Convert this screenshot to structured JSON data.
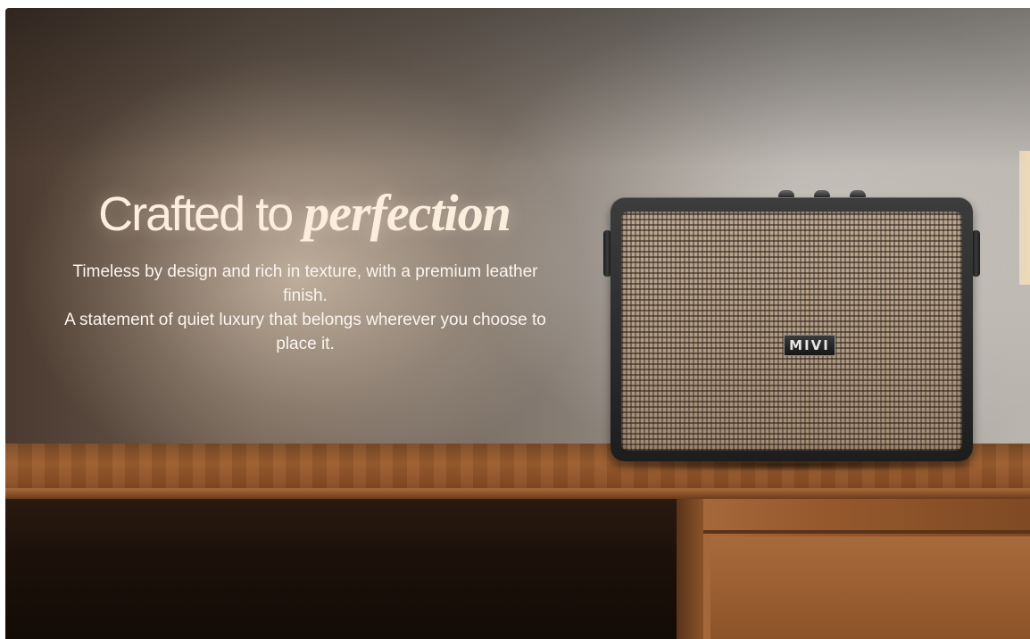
{
  "hero": {
    "headline_plain": "Crafted to ",
    "headline_emphasis": "perfection",
    "description_line1": "Timeless by design and rich in texture, with a premium leather finish.",
    "description_line2": "A statement of quiet luxury that belongs wherever you choose to place it."
  },
  "product": {
    "brand_badge": "MIVI"
  },
  "colors": {
    "headline_text": "#fbeedd",
    "body_text": "#fbf5ef",
    "wood_accent": "#9a5d30",
    "speaker_body": "#2a2a2a",
    "grille": "#b29c84"
  }
}
